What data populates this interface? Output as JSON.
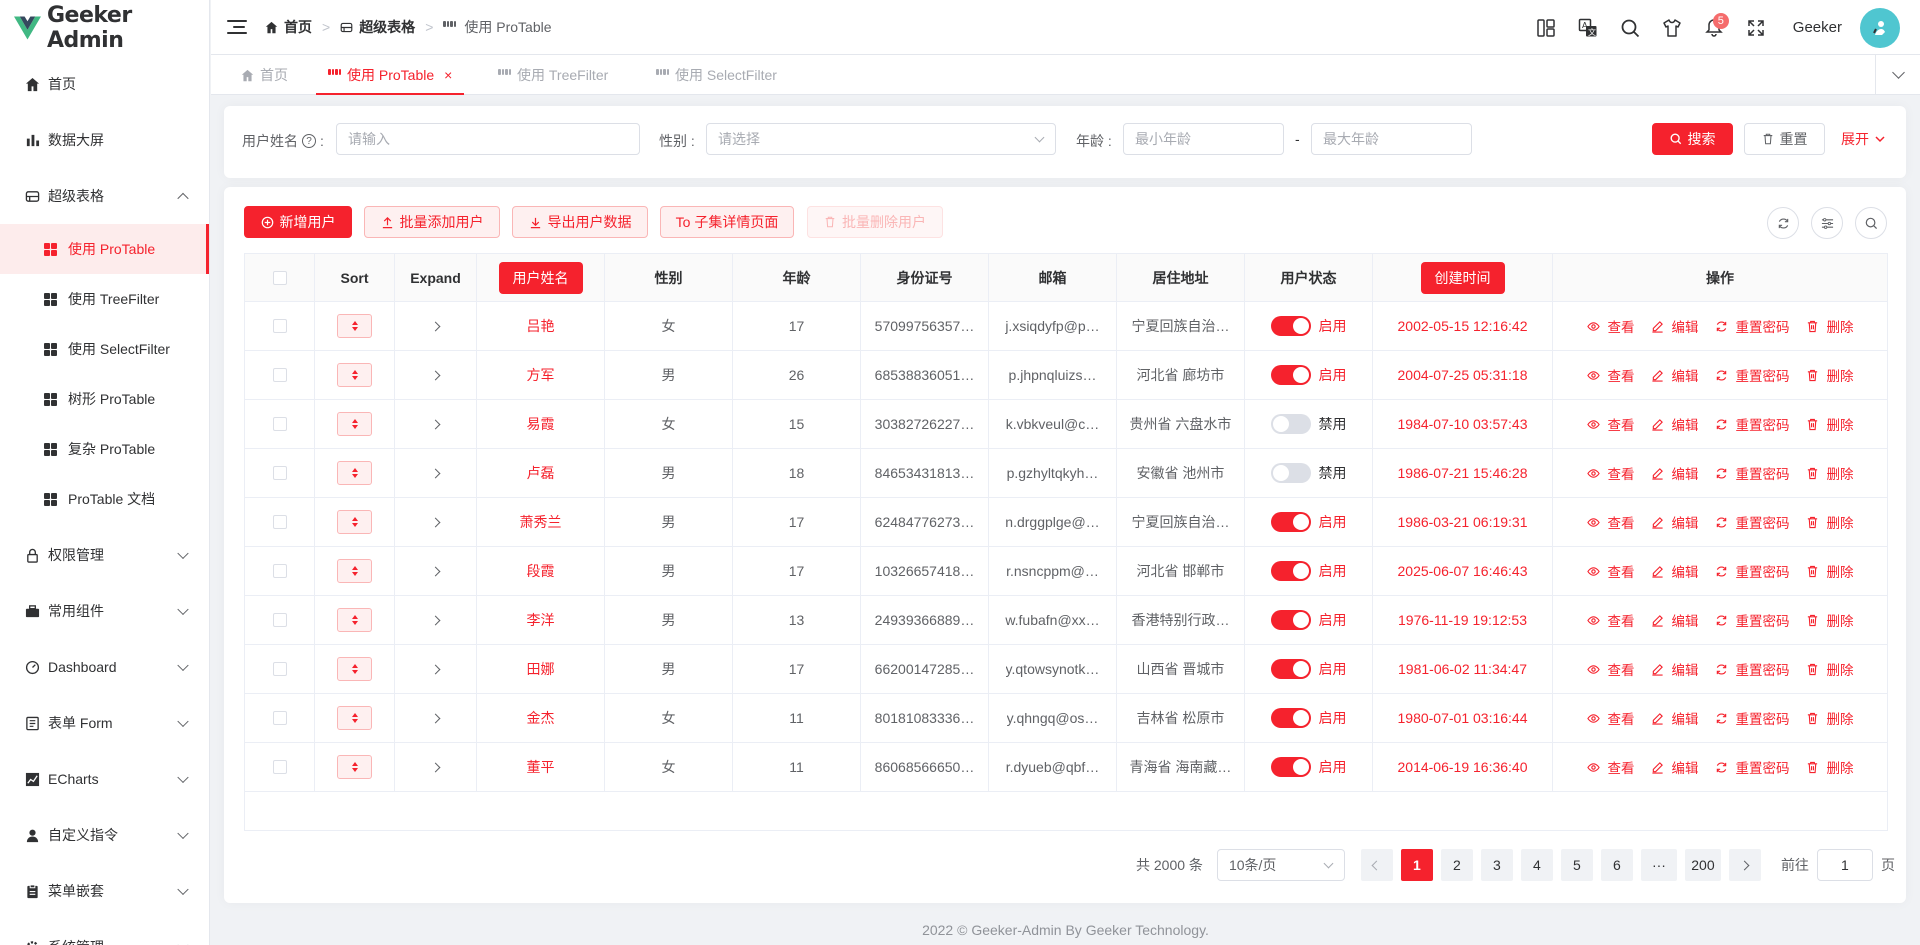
{
  "app": {
    "title": "Geeker Admin",
    "accent": "#f5222d"
  },
  "sidebar": {
    "items": [
      {
        "label": "首页",
        "icon": "home-icon"
      },
      {
        "label": "数据大屏",
        "icon": "bar-chart-icon"
      },
      {
        "label": "超级表格",
        "icon": "table-box-icon",
        "expanded": true,
        "children": [
          "使用 ProTable",
          "使用 TreeFilter",
          "使用 SelectFilter",
          "树形 ProTable",
          "复杂 ProTable",
          "ProTable 文档"
        ]
      },
      {
        "label": "权限管理",
        "icon": "lock-icon"
      },
      {
        "label": "常用组件",
        "icon": "briefcase-icon"
      },
      {
        "label": "Dashboard",
        "icon": "dashboard-icon"
      },
      {
        "label": "表单 Form",
        "icon": "form-icon"
      },
      {
        "label": "ECharts",
        "icon": "line-chart-icon"
      },
      {
        "label": "自定义指令",
        "icon": "user-icon"
      },
      {
        "label": "菜单嵌套",
        "icon": "clipboard-icon"
      },
      {
        "label": "系统管理",
        "icon": "setting-icon"
      }
    ],
    "active_child": "使用 ProTable"
  },
  "header": {
    "breadcrumb": [
      "首页",
      "超级表格",
      "使用 ProTable"
    ],
    "notification_count": "5",
    "username": "Geeker"
  },
  "tabs": [
    "首页",
    "使用 ProTable",
    "使用 TreeFilter",
    "使用 SelectFilter"
  ],
  "tab_close": "×",
  "search": {
    "username_label": "用户姓名",
    "username_placeholder": "请输入",
    "gender_label": "性别 :",
    "gender_placeholder": "请选择",
    "age_label": "年龄 :",
    "age_min_placeholder": "最小年龄",
    "age_sep": "-",
    "age_max_placeholder": "最大年龄",
    "search_btn": "搜索",
    "reset_btn": "重置",
    "expand_btn": "展开"
  },
  "toolbar": {
    "add_user": "新增用户",
    "batch_add": "批量添加用户",
    "export": "导出用户数据",
    "to_detail": "To 子集详情页面",
    "batch_delete": "批量删除用户"
  },
  "table": {
    "columns": [
      "Sort",
      "Expand",
      "用户姓名",
      "性别",
      "年龄",
      "身份证号",
      "邮箱",
      "居住地址",
      "用户状态",
      "创建时间",
      "操作"
    ],
    "actions": [
      "查看",
      "编辑",
      "重置密码",
      "删除"
    ],
    "rows": [
      {
        "name": "吕艳",
        "gender": "女",
        "age": "17",
        "idcard": "57099756357…",
        "email": "j.xsiqdyfp@p…",
        "address": "宁夏回族自治…",
        "enabled": true,
        "status": "启用",
        "created": "2002-05-15 12:16:42"
      },
      {
        "name": "方军",
        "gender": "男",
        "age": "26",
        "idcard": "68538836051…",
        "email": "p.jhpnqluizs…",
        "address": "河北省 廊坊市",
        "enabled": true,
        "status": "启用",
        "created": "2004-07-25 05:31:18"
      },
      {
        "name": "易霞",
        "gender": "女",
        "age": "15",
        "idcard": "30382726227…",
        "email": "k.vbkveul@c…",
        "address": "贵州省 六盘水市",
        "enabled": false,
        "status": "禁用",
        "created": "1984-07-10 03:57:43"
      },
      {
        "name": "卢磊",
        "gender": "男",
        "age": "18",
        "idcard": "84653431813…",
        "email": "p.gzhyltqkyh…",
        "address": "安徽省 池州市",
        "enabled": false,
        "status": "禁用",
        "created": "1986-07-21 15:46:28"
      },
      {
        "name": "萧秀兰",
        "gender": "男",
        "age": "17",
        "idcard": "62484776273…",
        "email": "n.drggplge@…",
        "address": "宁夏回族自治…",
        "enabled": true,
        "status": "启用",
        "created": "1986-03-21 06:19:31"
      },
      {
        "name": "段霞",
        "gender": "男",
        "age": "17",
        "idcard": "10326657418…",
        "email": "r.nsncppm@…",
        "address": "河北省 邯郸市",
        "enabled": true,
        "status": "启用",
        "created": "2025-06-07 16:46:43"
      },
      {
        "name": "李洋",
        "gender": "男",
        "age": "13",
        "idcard": "24939366889…",
        "email": "w.fubafn@xx…",
        "address": "香港特别行政…",
        "enabled": true,
        "status": "启用",
        "created": "1976-11-19 19:12:53"
      },
      {
        "name": "田娜",
        "gender": "男",
        "age": "17",
        "idcard": "66200147285…",
        "email": "y.qtowsynotk…",
        "address": "山西省 晋城市",
        "enabled": true,
        "status": "启用",
        "created": "1981-06-02 11:34:47"
      },
      {
        "name": "金杰",
        "gender": "女",
        "age": "11",
        "idcard": "80181083336…",
        "email": "y.qhngq@os…",
        "address": "吉林省 松原市",
        "enabled": true,
        "status": "启用",
        "created": "1980-07-01 03:16:44"
      },
      {
        "name": "董平",
        "gender": "女",
        "age": "11",
        "idcard": "86068566650…",
        "email": "r.dyueb@qbf…",
        "address": "青海省 海南藏…",
        "enabled": true,
        "status": "启用",
        "created": "2014-06-19 16:36:40"
      }
    ]
  },
  "pagination": {
    "total": "共 2000 条",
    "page_size": "10条/页",
    "pages": [
      "1",
      "2",
      "3",
      "4",
      "5",
      "6",
      "···",
      "200"
    ],
    "current": "1",
    "goto_label": "前往",
    "goto_value": "1",
    "goto_suffix": "页"
  },
  "footer": "2022 © Geeker-Admin By Geeker Technology."
}
